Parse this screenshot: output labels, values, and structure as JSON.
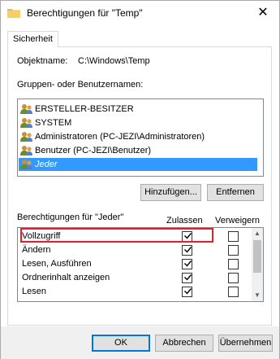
{
  "window": {
    "title": "Berechtigungen für \"Temp\"",
    "close_glyph": "✕"
  },
  "tab": {
    "label": "Sicherheit"
  },
  "object": {
    "label": "Objektname:",
    "value": "C:\\Windows\\Temp"
  },
  "groups": {
    "label": "Gruppen- oder Benutzernamen:",
    "items": [
      {
        "label": "ERSTELLER-BESITZER",
        "icon": "users-icon"
      },
      {
        "label": "SYSTEM",
        "icon": "users-icon"
      },
      {
        "label": "Administratoren (PC-JEZI\\Administratoren)",
        "icon": "users-icon"
      },
      {
        "label": "Benutzer (PC-JEZI\\Benutzer)",
        "icon": "users-icon"
      },
      {
        "label": "Jeder",
        "icon": "users-icon",
        "selected": true
      }
    ]
  },
  "buttons": {
    "add": "Hinzufügen...",
    "remove": "Entfernen",
    "ok": "OK",
    "cancel": "Abbrechen",
    "apply": "Übernehmen"
  },
  "permissions": {
    "label": "Berechtigungen für \"Jeder\"",
    "col_allow": "Zulassen",
    "col_deny": "Verweigern",
    "rows": [
      {
        "name": "Vollzugriff",
        "allow": true,
        "deny": false
      },
      {
        "name": "Ändern",
        "allow": true,
        "deny": false
      },
      {
        "name": "Lesen, Ausführen",
        "allow": true,
        "deny": false
      },
      {
        "name": "Ordnerinhalt anzeigen",
        "allow": true,
        "deny": false
      },
      {
        "name": "Lesen",
        "allow": true,
        "deny": false
      }
    ]
  },
  "colors": {
    "selection": "#3399ff",
    "highlight_border": "#e0202a",
    "default_button_border": "#0078d7"
  }
}
